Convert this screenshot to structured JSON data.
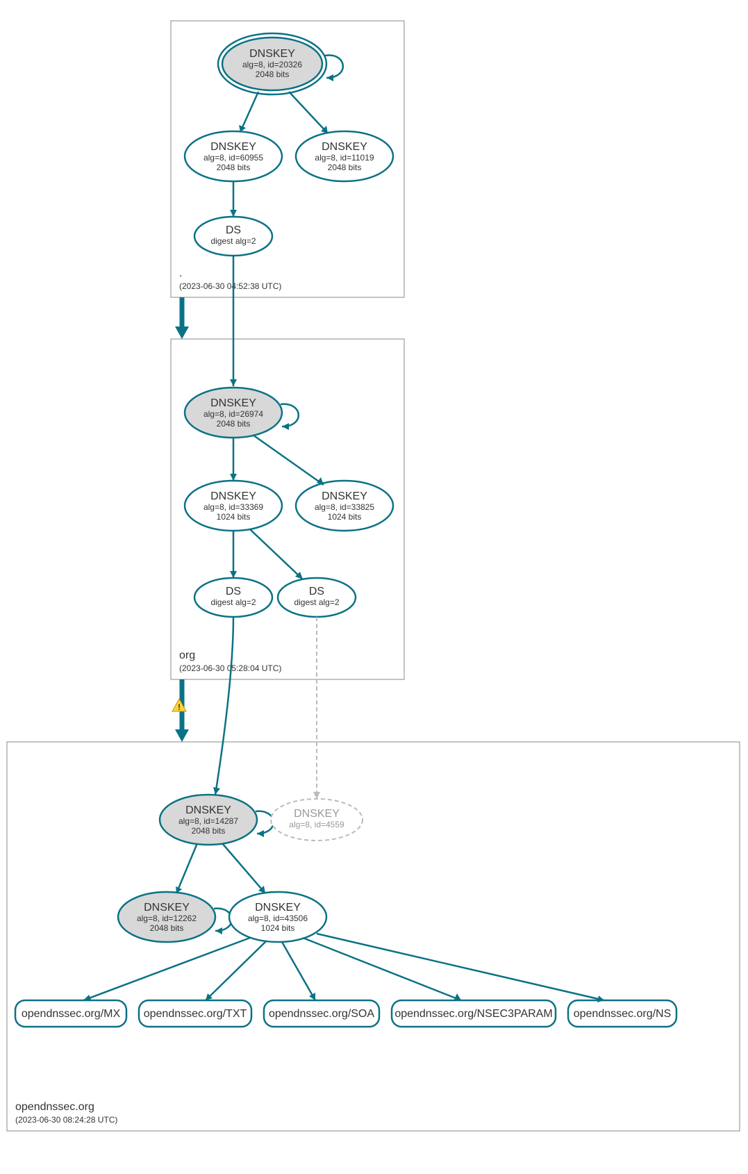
{
  "zones": {
    "root": {
      "label": ".",
      "timestamp": "(2023-06-30 04:52:38 UTC)"
    },
    "org": {
      "label": "org",
      "timestamp": "(2023-06-30 05:28:04 UTC)"
    },
    "leaf": {
      "label": "opendnssec.org",
      "timestamp": "(2023-06-30 08:24:28 UTC)"
    }
  },
  "nodes": {
    "rootKSK": {
      "title": "DNSKEY",
      "l1": "alg=8, id=20326",
      "l2": "2048 bits"
    },
    "rootZSK1": {
      "title": "DNSKEY",
      "l1": "alg=8, id=60955",
      "l2": "2048 bits"
    },
    "rootZSK2": {
      "title": "DNSKEY",
      "l1": "alg=8, id=11019",
      "l2": "2048 bits"
    },
    "rootDS": {
      "title": "DS",
      "l1": "digest alg=2",
      "l2": ""
    },
    "orgKSK": {
      "title": "DNSKEY",
      "l1": "alg=8, id=26974",
      "l2": "2048 bits"
    },
    "orgZSK1": {
      "title": "DNSKEY",
      "l1": "alg=8, id=33369",
      "l2": "1024 bits"
    },
    "orgZSK2": {
      "title": "DNSKEY",
      "l1": "alg=8, id=33825",
      "l2": "1024 bits"
    },
    "orgDS1": {
      "title": "DS",
      "l1": "digest alg=2",
      "l2": ""
    },
    "orgDS2": {
      "title": "DS",
      "l1": "digest alg=2",
      "l2": ""
    },
    "leafKSK": {
      "title": "DNSKEY",
      "l1": "alg=8, id=14287",
      "l2": "2048 bits"
    },
    "leafGhost": {
      "title": "DNSKEY",
      "l1": "alg=8, id=4559",
      "l2": ""
    },
    "leafZSKg": {
      "title": "DNSKEY",
      "l1": "alg=8, id=12262",
      "l2": "2048 bits"
    },
    "leafZSK": {
      "title": "DNSKEY",
      "l1": "alg=8, id=43506",
      "l2": "1024 bits"
    }
  },
  "rrsets": {
    "mx": "opendnssec.org/MX",
    "txt": "opendnssec.org/TXT",
    "soa": "opendnssec.org/SOA",
    "nsec": "opendnssec.org/NSEC3PARAM",
    "ns": "opendnssec.org/NS"
  }
}
